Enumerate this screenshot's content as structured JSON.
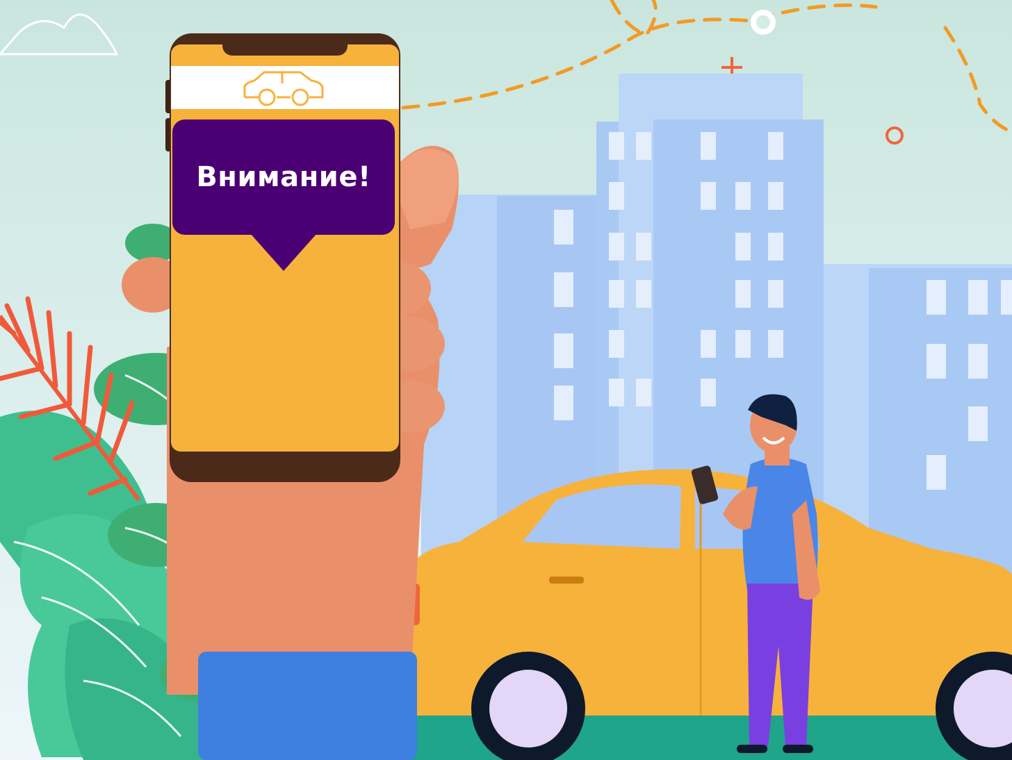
{
  "notification": {
    "text": "Внимание!"
  },
  "icons": {
    "phone_header": "car-icon"
  },
  "colors": {
    "background": "#cfe8e0",
    "buildings": "#a9c9f5",
    "taxi": "#f7b23b",
    "phone_body": "#f7b23b",
    "bubble": "#4a0072",
    "sleeve": "#3f7fe0",
    "skin": "#e9906a",
    "plants": "#3fbf8f",
    "dashed_path": "#f39a24"
  }
}
